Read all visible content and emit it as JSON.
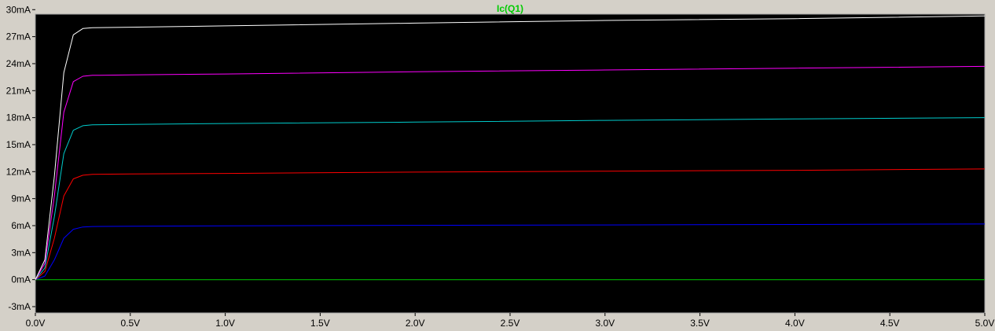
{
  "chart_data": {
    "type": "line",
    "title": "Ic(Q1)",
    "xlabel": "",
    "ylabel": "",
    "xlim": [
      0,
      5
    ],
    "ylim": [
      -3,
      30
    ],
    "grid": false,
    "x_ticks": [
      "0.0V",
      "0.5V",
      "1.0V",
      "1.5V",
      "2.0V",
      "2.5V",
      "3.0V",
      "3.5V",
      "4.0V",
      "4.5V",
      "5.0V"
    ],
    "y_ticks": [
      "-3mA",
      "0mA",
      "3mA",
      "6mA",
      "9mA",
      "12mA",
      "15mA",
      "18mA",
      "21mA",
      "24mA",
      "27mA",
      "30mA"
    ],
    "x_tick_values": [
      0,
      0.5,
      1.0,
      1.5,
      2.0,
      2.5,
      3.0,
      3.5,
      4.0,
      4.5,
      5.0
    ],
    "y_tick_values": [
      -3,
      0,
      3,
      6,
      9,
      12,
      15,
      18,
      21,
      24,
      27,
      30
    ],
    "series": [
      {
        "color": "#00cc00",
        "x": [
          0,
          5.0
        ],
        "y": [
          0,
          0
        ]
      },
      {
        "color": "#0000ff",
        "x": [
          0,
          0.05,
          0.1,
          0.15,
          0.2,
          0.25,
          0.3,
          0.5,
          1.0,
          2.0,
          3.0,
          4.0,
          5.0
        ],
        "y": [
          0,
          0.4,
          2.2,
          4.6,
          5.6,
          5.85,
          5.9,
          5.93,
          5.97,
          6.03,
          6.08,
          6.13,
          6.18
        ]
      },
      {
        "color": "#ff0000",
        "x": [
          0,
          0.05,
          0.1,
          0.15,
          0.2,
          0.25,
          0.3,
          0.5,
          1.0,
          2.0,
          3.0,
          4.0,
          5.0
        ],
        "y": [
          0,
          0.9,
          4.6,
          9.3,
          11.2,
          11.6,
          11.7,
          11.75,
          11.8,
          11.95,
          12.05,
          12.15,
          12.3
        ]
      },
      {
        "color": "#00cccc",
        "x": [
          0,
          0.05,
          0.1,
          0.15,
          0.2,
          0.25,
          0.3,
          0.5,
          1.0,
          2.0,
          3.0,
          4.0,
          5.0
        ],
        "y": [
          0,
          1.3,
          7.0,
          14.0,
          16.6,
          17.1,
          17.2,
          17.25,
          17.35,
          17.5,
          17.7,
          17.85,
          18.0
        ]
      },
      {
        "color": "#ff00ff",
        "x": [
          0,
          0.05,
          0.1,
          0.15,
          0.2,
          0.25,
          0.3,
          0.5,
          1.0,
          2.0,
          3.0,
          4.0,
          5.0
        ],
        "y": [
          0,
          1.8,
          9.3,
          18.6,
          22.0,
          22.6,
          22.7,
          22.75,
          22.85,
          23.1,
          23.3,
          23.5,
          23.7
        ]
      },
      {
        "color": "#ffffff",
        "x": [
          0,
          0.05,
          0.1,
          0.15,
          0.2,
          0.25,
          0.3,
          0.5,
          1.0,
          2.0,
          3.0,
          4.0,
          5.0
        ],
        "y": [
          0,
          2.2,
          11.5,
          23.0,
          27.2,
          27.9,
          28.0,
          28.05,
          28.2,
          28.5,
          28.8,
          29.0,
          29.3
        ]
      }
    ],
    "colors": {
      "background": "#000000",
      "axis": "#a0a0a0",
      "title": "#00cc00",
      "frame": "#d4d0c8"
    }
  }
}
